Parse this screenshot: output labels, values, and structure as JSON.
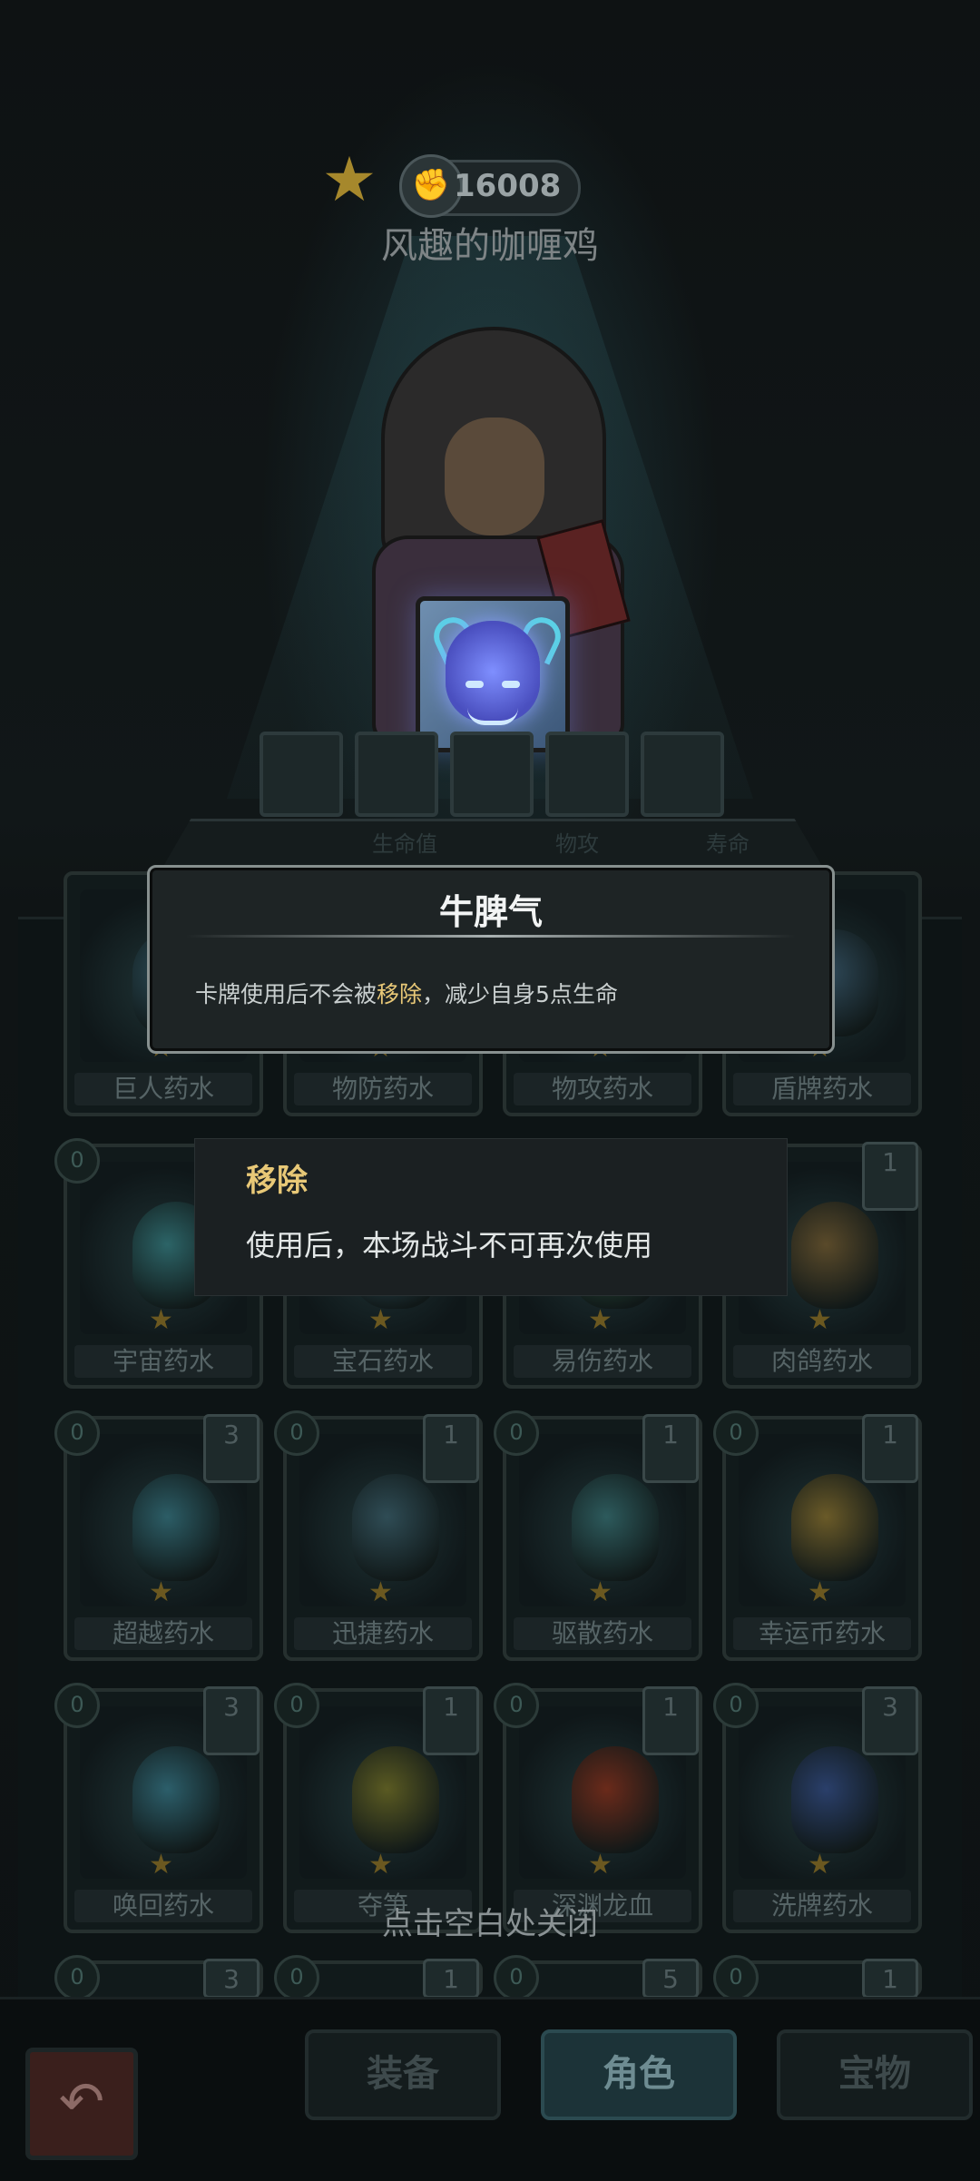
{
  "header": {
    "score": "16008",
    "player_name": "风趣的咖喱鸡"
  },
  "stats": {
    "labels": [
      "生命值",
      "物攻",
      "寿命"
    ]
  },
  "card_tooltip": {
    "title": "牛脾气",
    "desc_before": "卡牌使用后不会被",
    "desc_keyword": "移除",
    "desc_after": "，减少自身5点生命"
  },
  "term_tooltip": {
    "title": "移除",
    "description": "使用后，本场战斗不可再次使用"
  },
  "potions": [
    {
      "name": "巨人药水",
      "cost": "",
      "count": "",
      "color": "#2a4a55"
    },
    {
      "name": "物防药水",
      "cost": "",
      "count": "",
      "color": "#3a4a55"
    },
    {
      "name": "物攻药水",
      "cost": "",
      "count": "",
      "color": "#3a3f45"
    },
    {
      "name": "盾牌药水",
      "cost": "",
      "count": "",
      "color": "#2f4a5a"
    },
    {
      "name": "宇宙药水",
      "cost": "0",
      "count": "",
      "color": "#2c6467"
    },
    {
      "name": "宝石药水",
      "cost": "",
      "count": "",
      "color": "#355a68"
    },
    {
      "name": "易伤药水",
      "cost": "",
      "count": "",
      "color": "#2e5a44"
    },
    {
      "name": "肉鸽药水",
      "cost": "",
      "count": "1",
      "color": "#5a4a2a"
    },
    {
      "name": "超越药水",
      "cost": "0",
      "count": "3",
      "color": "#2c5d66"
    },
    {
      "name": "迅捷药水",
      "cost": "0",
      "count": "1",
      "color": "#2f4c55"
    },
    {
      "name": "驱散药水",
      "cost": "0",
      "count": "1",
      "color": "#2d5a5c"
    },
    {
      "name": "幸运币药水",
      "cost": "0",
      "count": "1",
      "color": "#6a5a28"
    },
    {
      "name": "唤回药水",
      "cost": "0",
      "count": "3",
      "color": "#2c5e6a"
    },
    {
      "name": "夺笋",
      "cost": "0",
      "count": "1",
      "color": "#5a5a22"
    },
    {
      "name": "深渊龙血",
      "cost": "0",
      "count": "1",
      "color": "#6a2a1a"
    },
    {
      "name": "洗牌药水",
      "cost": "0",
      "count": "3",
      "color": "#2a3f6a"
    }
  ],
  "partial_row": [
    {
      "cost": "0",
      "count": "3"
    },
    {
      "cost": "0",
      "count": "1"
    },
    {
      "cost": "0",
      "count": "5"
    },
    {
      "cost": "0",
      "count": "1"
    }
  ],
  "close_hint": "点击空白处关闭",
  "nav": {
    "tabs": [
      "装备",
      "角色",
      "宝物"
    ],
    "active": "角色"
  }
}
